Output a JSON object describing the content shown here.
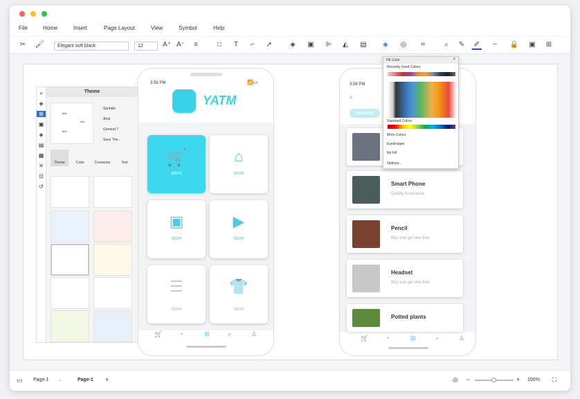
{
  "window": {
    "title": ""
  },
  "menu": [
    "File",
    "Home",
    "Insert",
    "Page Layout",
    "View",
    "Symbol",
    "Help"
  ],
  "toolbar": {
    "font": "Elegant soft black",
    "size": "12"
  },
  "panel": {
    "title": "Theme",
    "options": [
      "Sprinkle",
      "Arial",
      "General 7",
      "Save The..."
    ],
    "tabs": [
      "Theme",
      "Color",
      "Connector",
      "Text"
    ],
    "sample_labels": [
      "text",
      "text",
      "text"
    ]
  },
  "phone1": {
    "time": "3:58 PM",
    "brand": "YATM",
    "tiles": [
      "store",
      "store",
      "store",
      "store",
      "store",
      "store"
    ]
  },
  "phone2": {
    "time": "3:58 PM",
    "tab": "Featured",
    "cards": [
      {
        "title": "Smart Phone",
        "sub": "Quality Assurance"
      },
      {
        "title": "Pencil",
        "sub": "Buy one get one free"
      },
      {
        "title": "Headset",
        "sub": "Buy one get one free"
      },
      {
        "title": "Potted plants",
        "sub": ""
      }
    ]
  },
  "fill_popup": {
    "title": "Fill Color",
    "recent": "Recently Used Colors",
    "standard": "Standard Colors",
    "more": "More Colors",
    "eyedropper": "Eyedropper",
    "nofill": "No Fill",
    "options": "Options..."
  },
  "status": {
    "page_sel": "Page-1",
    "page_tab": "Page-1",
    "add": "+",
    "zoom": "100%"
  }
}
